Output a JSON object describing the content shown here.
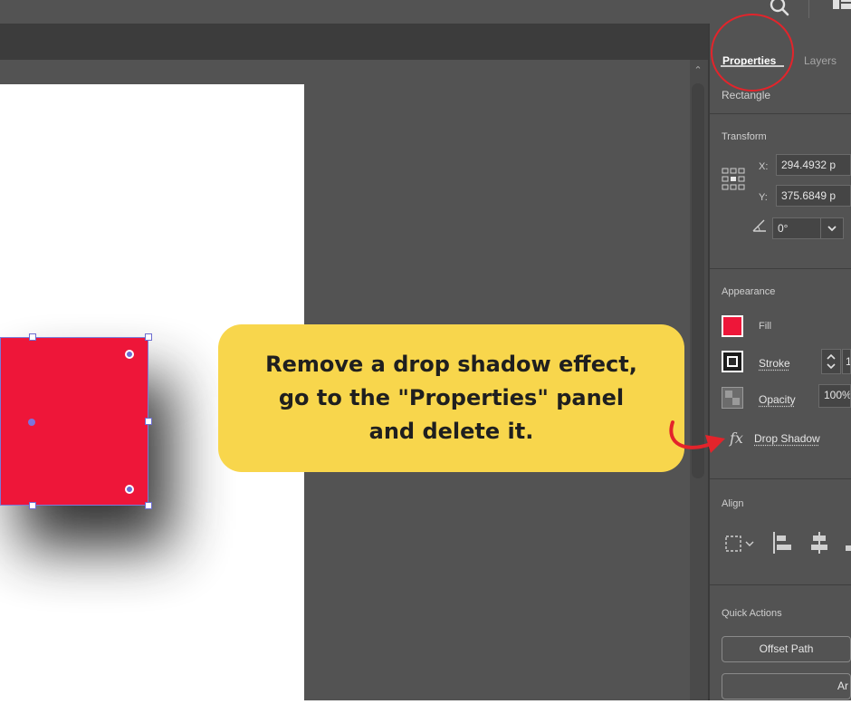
{
  "panel": {
    "tabs": [
      {
        "label": "Properties",
        "active": true
      },
      {
        "label": "Layers",
        "active": false
      }
    ],
    "object_type": "Rectangle",
    "transform": {
      "title": "Transform",
      "x_label": "X:",
      "x_value": "294.4932 p",
      "y_label": "Y:",
      "y_value": "375.6849 p",
      "angle_value": "0°"
    },
    "appearance": {
      "title": "Appearance",
      "fill_label": "Fill",
      "fill_color": "#ee1639",
      "stroke_label": "Stroke",
      "stroke_value": "1",
      "opacity_label": "Opacity",
      "opacity_value": "100%",
      "effect_label": "Drop Shadow",
      "fx_label": "fx"
    },
    "align": {
      "title": "Align"
    },
    "quick_actions": {
      "title": "Quick Actions",
      "offset_path_label": "Offset Path",
      "second_button_label": "Ar"
    }
  },
  "callout": {
    "text": "Remove a drop shadow effect,\ngo to the \"Properties\" panel\nand delete it.",
    "color": "#f8d64c"
  },
  "canvas": {
    "rect_color": "#ee1639",
    "selection_color": "#6c6cd0"
  },
  "annotation_color": "#e3242b"
}
